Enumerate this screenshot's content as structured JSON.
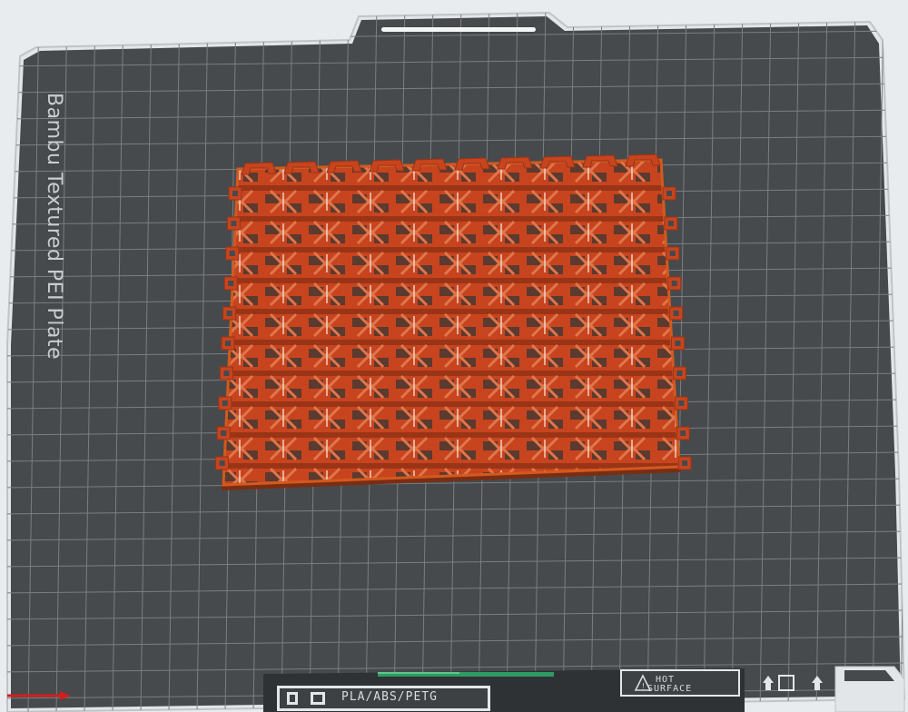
{
  "plate": {
    "title": "Bambu Textured PEI Plate",
    "material_label": "PLA/ABS/PETG",
    "hot_surface_line1": "HOT",
    "hot_surface_line2": "SURFACE"
  },
  "model": {
    "grid_columns": 10,
    "grid_rows": 10,
    "primary_color": "#c7441f",
    "shade_color": "#9a3416",
    "edge_color": "#d25a1e"
  },
  "colors": {
    "plate_dark": "#464a4c",
    "plate_edge": "#dfe2e4",
    "grid_line": "#7a7e80",
    "background": "#e9ecee",
    "origin_axis": "#d21f1f",
    "alignment_strip": "#2f9a63"
  }
}
